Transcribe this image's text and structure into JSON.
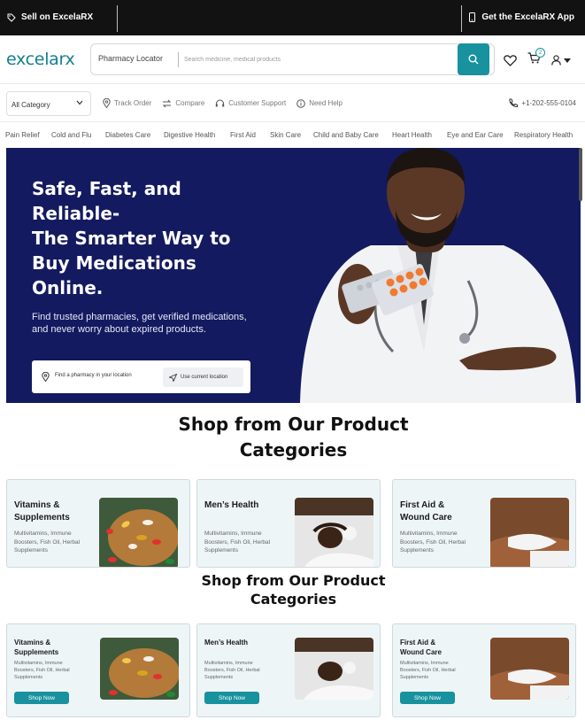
{
  "topbar": {
    "sell_label": "Sell on ExcelaRX",
    "app_label": "Get the ExcelaRX App"
  },
  "header": {
    "logo": "excelarx",
    "locator_label": "Pharmacy Locator",
    "search_placeholder": "Search medicine, medical products",
    "cart_count": "2"
  },
  "subnav": {
    "category_label": "All Category",
    "links": [
      "Track Order",
      "Compare",
      "Customer Support",
      "Need Help"
    ],
    "phone": "+1-202-555-0104"
  },
  "categories": [
    "Pain Relief",
    "Cold and Flu",
    "Diabetes Care",
    "Digestive Health",
    "First Aid",
    "Skin Care",
    "Child and Baby Care",
    "Heart Health",
    "Eye and Ear Care",
    "Respiratory Health"
  ],
  "hero": {
    "title_line1": "Safe, Fast, and",
    "title_line2": "Reliable-",
    "title_line3": "The Smarter Way to",
    "title_line4": "Buy Medications",
    "title_line5": "Online.",
    "subtitle": "Find trusted pharmacies, get verified medications, and never worry about expired products.",
    "find_label": "Find a pharmacy in your location",
    "use_location_label": "Use current location"
  },
  "section": {
    "title_line1": "Shop from Our Product",
    "title_line2": "Categories"
  },
  "cards": [
    {
      "title_line1": "Vitamins &",
      "title_line2": "Supplements",
      "desc_line1": "Multivitamins, Immune",
      "desc_line2": "Boosters, Fish Oil, Herbal",
      "desc_line3": "Supplements"
    },
    {
      "title_line1": "Men’s Health",
      "title_line2": "",
      "desc_line1": "Multivitamins, Immune",
      "desc_line2": "Boosters, Fish Oil, Herbal",
      "desc_line3": "Supplements"
    },
    {
      "title_line1": "First Aid &",
      "title_line2": "Wound Care",
      "desc_line1": "Multivitamins, Immune",
      "desc_line2": "Boosters, Fish Oil, Herbal",
      "desc_line3": "Supplements"
    }
  ],
  "shop_now_label": "Shop Now",
  "colors": {
    "accent": "#17929e",
    "hero_bg": "#131a60",
    "card_bg": "#eef5f7"
  }
}
